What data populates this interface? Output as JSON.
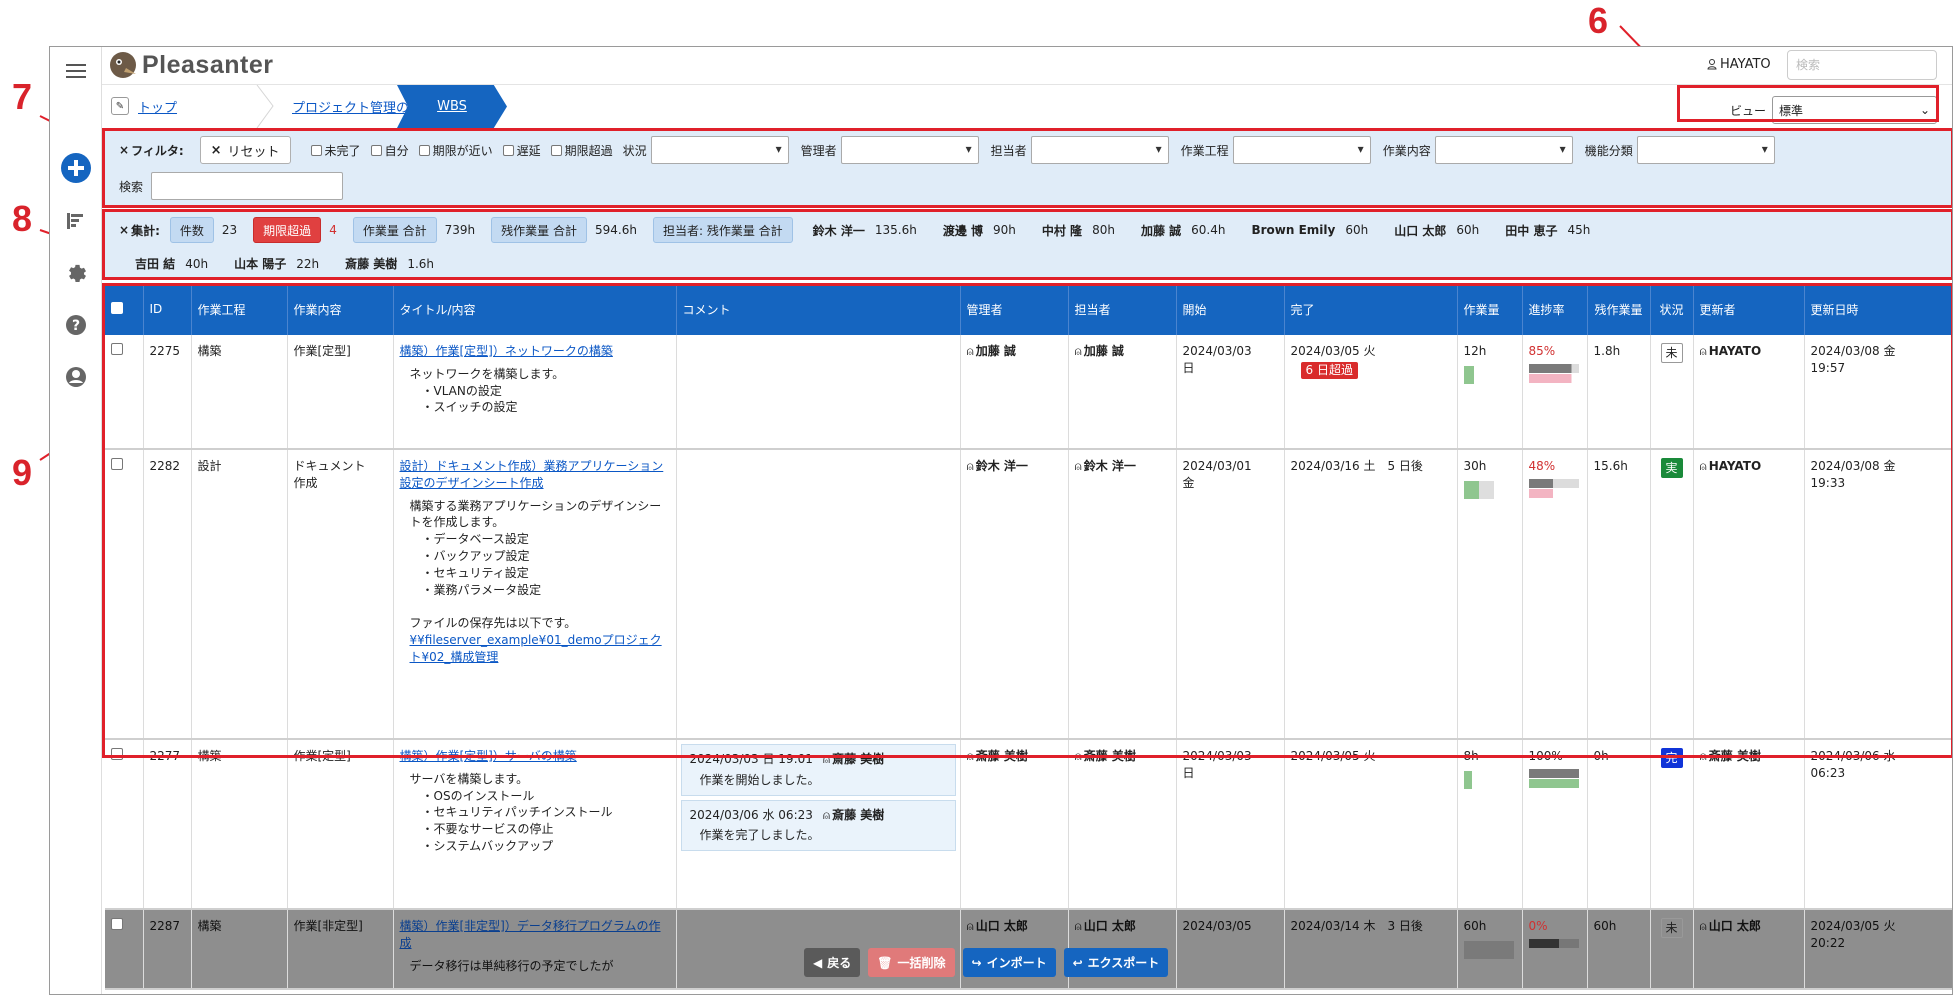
{
  "annotations": [
    "6",
    "7",
    "8",
    "9"
  ],
  "colors": {
    "accent": "#1565c0",
    "annotation": "#e0202a",
    "overdue": "#d92c2c"
  },
  "sidebar": {
    "icons": [
      "menu-icon",
      "add-icon",
      "gantt-icon",
      "gear-icon",
      "help-icon",
      "account-icon"
    ]
  },
  "header": {
    "logo": "Pleasanter",
    "user": "HAYATO",
    "search_placeholder": "検索"
  },
  "breadcrumb": {
    "items": [
      "トップ",
      "プロジェクト管理の例",
      "WBS"
    ]
  },
  "view": {
    "label": "ビュー",
    "selected": "標準"
  },
  "filter": {
    "title": "フィルタ:",
    "reset": "リセット",
    "checks": [
      "未完了",
      "自分",
      "期限が近い",
      "遅延",
      "期限超過"
    ],
    "dropdowns": [
      "状況",
      "管理者",
      "担当者",
      "作業工程",
      "作業内容",
      "機能分類"
    ],
    "search_label": "検索"
  },
  "aggregate": {
    "title": "集計:",
    "count_label": "件数",
    "count_value": "23",
    "overdue_label": "期限超過",
    "overdue_value": "4",
    "work_label": "作業量 合計",
    "work_value": "739h",
    "remain_label": "残作業量 合計",
    "remain_value": "594.6h",
    "assignee_label": "担当者: 残作業量 合計",
    "people": [
      {
        "name": "鈴木 洋一",
        "value": "135.6h"
      },
      {
        "name": "渡邊 博",
        "value": "90h"
      },
      {
        "name": "中村 隆",
        "value": "80h"
      },
      {
        "name": "加藤 誠",
        "value": "60.4h"
      },
      {
        "name": "Brown Emily",
        "value": "60h"
      },
      {
        "name": "山口 太郎",
        "value": "60h"
      },
      {
        "name": "田中 恵子",
        "value": "45h"
      },
      {
        "name": "吉田 結",
        "value": "40h"
      },
      {
        "name": "山本 陽子",
        "value": "22h"
      },
      {
        "name": "斎藤 美樹",
        "value": "1.6h"
      }
    ]
  },
  "grid": {
    "headers": [
      "ID",
      "作業工程",
      "作業内容",
      "タイトル/内容",
      "コメント",
      "管理者",
      "担当者",
      "開始",
      "完了",
      "作業量",
      "進捗率",
      "残作業量",
      "状況",
      "更新者",
      "更新日時"
    ],
    "rows": [
      {
        "id": "2275",
        "process": "構築",
        "content": "作業[定型]",
        "title": "構築）作業[定型]）ネットワークの構築",
        "body": "ネットワークを構築します。\n　・VLANの設定\n　・スイッチの設定",
        "manager": "加藤 誠",
        "assignee": "加藤 誠",
        "start": "2024/03/03\n日",
        "end": "2024/03/05 火",
        "end_note": "6 日超過",
        "work": "12h",
        "progress": "85%",
        "progress_value": 85,
        "remain": "1.8h",
        "status": "未",
        "updater": "HAYATO",
        "updated": "2024/03/08 金\n19:57"
      },
      {
        "id": "2282",
        "process": "設計",
        "content": "ドキュメント\n作成",
        "title": "設計）ドキュメント作成）業務アプリケーション設定のデザインシート作成",
        "body": "構築する業務アプリケーションのデザインシートを作成します。\n　・データベース設定\n　・バックアップ設定\n　・セキュリティ設定\n　・業務パラメータ設定\n\nファイルの保存先は以下です。\n",
        "link": "¥¥fileserver_example¥01_demoプロジェクト¥02_構成管理",
        "manager": "鈴木 洋一",
        "assignee": "鈴木 洋一",
        "start": "2024/03/01\n金",
        "end": "2024/03/16 土",
        "end_note": "5 日後",
        "work": "30h",
        "progress": "48%",
        "progress_value": 48,
        "remain": "15.6h",
        "status": "実",
        "updater": "HAYATO",
        "updated": "2024/03/08 金\n19:33"
      },
      {
        "id": "2277",
        "process": "構築",
        "content": "作業[定型]",
        "title": "構築）作業[定型]）サーバの構築",
        "body": "サーバを構築します。\n　・OSのインストール\n　・セキュリティパッチインストール\n　・不要なサービスの停止\n　・システムバックアップ",
        "comments": [
          {
            "time": "2024/03/03 日 19:01",
            "user": "斎藤 美樹",
            "text": "作業を開始しました。"
          },
          {
            "time": "2024/03/06 水 06:23",
            "user": "斎藤 美樹",
            "text": "作業を完了しました。"
          }
        ],
        "manager": "斎藤 美樹",
        "assignee": "斎藤 美樹",
        "start": "2024/03/03\n日",
        "end": "2024/03/05 火",
        "work": "8h",
        "progress": "100%",
        "progress_value": 100,
        "remain": "0h",
        "status": "完",
        "updater": "斎藤 美樹",
        "updated": "2024/03/06 水\n06:23"
      },
      {
        "id": "2287",
        "process": "構築",
        "content": "作業[非定型]",
        "title": "構築）作業[非定型]）データ移行プログラムの作成",
        "body": "データ移行は単純移行の予定でしたが",
        "manager": "山口 太郎",
        "assignee": "山口 太郎",
        "start": "2024/03/05",
        "end": "2024/03/14 木",
        "end_note": "3 日後",
        "work": "60h",
        "progress": "0%",
        "progress_value": 0,
        "remain": "60h",
        "status": "未",
        "updater": "山口 太郎",
        "updated": "2024/03/05 火\n20:22"
      }
    ]
  },
  "actions": {
    "back": "戻る",
    "bulk_delete": "一括削除",
    "import": "インポート",
    "export": "エクスポート"
  }
}
